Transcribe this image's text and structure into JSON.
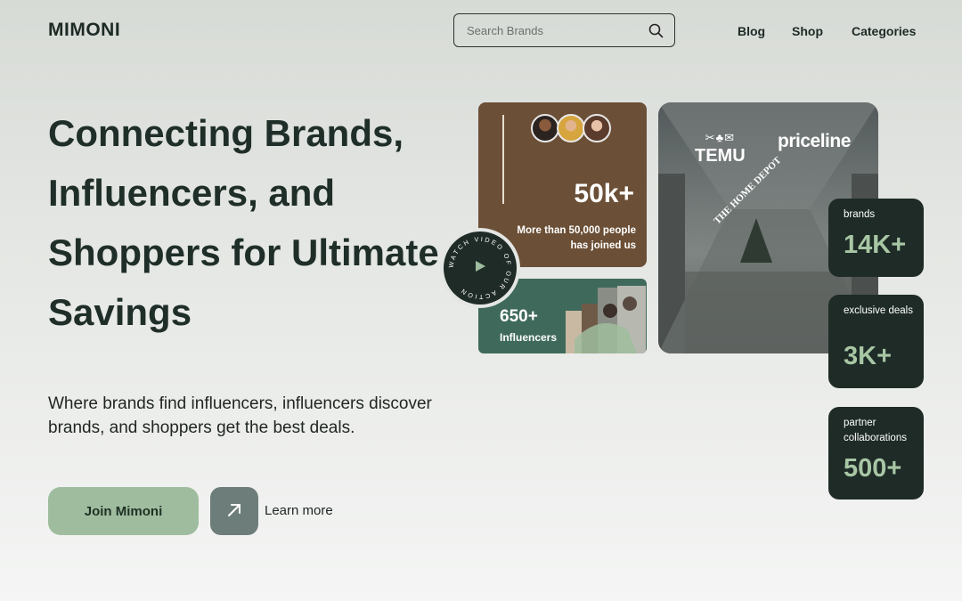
{
  "header": {
    "logo": "MIMONI",
    "search": {
      "placeholder": "Search Brands"
    },
    "nav": [
      {
        "label": "Blog"
      },
      {
        "label": "Shop"
      },
      {
        "label": "Categories"
      }
    ]
  },
  "hero": {
    "title": "Connecting Brands, Influencers, and Shoppers for Ultimate Savings",
    "subtitle": "Where brands find influencers, influencers discover brands, and shoppers get the best deals.",
    "join_label": "Join Mimoni",
    "learn_label": "Learn more"
  },
  "cards": {
    "community": {
      "count": "50k+",
      "caption": "More than 50,000 people has joined us"
    },
    "influencers": {
      "count": "650+",
      "label": "Influencers"
    },
    "watch_text": "WATCH VIDEO OF OUR ACTION",
    "brand_logos": [
      "TEMU",
      "priceline",
      "THE HOME DEPOT"
    ]
  },
  "stats": [
    {
      "label": "brands",
      "value": "14K+"
    },
    {
      "label": "exclusive deals",
      "value": "3K+"
    },
    {
      "label": "partner collaborations",
      "value": "500+"
    }
  ],
  "colors": {
    "accent_green": "#9fbd9e",
    "dark": "#1e2b27",
    "brown_card": "#6b4f36",
    "green_card": "#3f6a5b",
    "stat_value": "#a8c6a4"
  }
}
